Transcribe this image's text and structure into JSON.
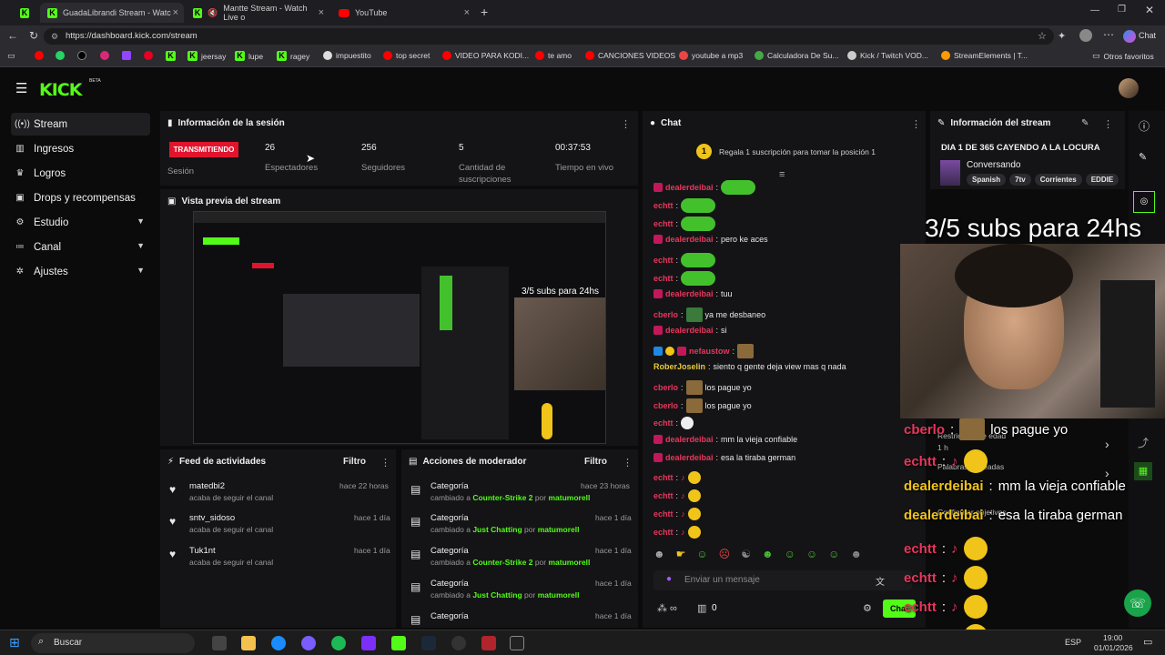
{
  "browser": {
    "tabs": [
      {
        "title": "GuadaLibrandi Stream - Watc"
      },
      {
        "title": "Mantte Stream - Watch Live o"
      },
      {
        "title": "YouTube"
      }
    ],
    "url": "https://dashboard.kick.com/stream",
    "bookmarks": [
      "jeersay",
      "lupe",
      "ragey",
      "impuestito",
      "top secret",
      "VIDEO PARA KODI...",
      "te amo",
      "CANCIONES VIDEOS",
      "youtube a mp3",
      "Calculadora De Su...",
      "Kick / Twitch VOD...",
      "StreamElements | T...",
      "Otros favoritos"
    ]
  },
  "app": {
    "logo": "KICK",
    "beta": "BETA"
  },
  "sidebar": {
    "items": [
      {
        "label": "Stream",
        "icon": "broadcast-icon"
      },
      {
        "label": "Ingresos",
        "icon": "bank-icon"
      },
      {
        "label": "Logros",
        "icon": "trophy-icon"
      },
      {
        "label": "Drops y recompensas",
        "icon": "gift-icon"
      },
      {
        "label": "Estudio",
        "icon": "gear-icon"
      },
      {
        "label": "Canal",
        "icon": "list-icon"
      },
      {
        "label": "Ajustes",
        "icon": "settings-icon"
      }
    ]
  },
  "session": {
    "title": "Información de la sesión",
    "live_badge": "TRANSMITIENDO",
    "stats": [
      {
        "value": "",
        "label": "Sesión"
      },
      {
        "value": "26",
        "label": "Espectadores"
      },
      {
        "value": "256",
        "label": "Seguidores"
      },
      {
        "value": "5",
        "label": "Cantidad de suscripciones"
      },
      {
        "value": "00:37:53",
        "label": "Tiempo en vivo"
      }
    ]
  },
  "preview": {
    "title": "Vista previa del stream",
    "overlay": "3/5 subs para 24hs"
  },
  "feed": {
    "title": "Feed de actividades",
    "filter": "Filtro",
    "items": [
      {
        "name": "matedbi2",
        "sub": "acaba de seguir el canal",
        "time": "hace 22 horas"
      },
      {
        "name": "sntv_sidoso",
        "sub": "acaba de seguir el canal",
        "time": "hace 1 día"
      },
      {
        "name": "Tuk1nt",
        "sub": "acaba de seguir el canal",
        "time": "hace 1 día"
      }
    ]
  },
  "mod": {
    "title": "Acciones de moderador",
    "filter": "Filtro",
    "items": [
      {
        "name": "Categoría",
        "pre": "cambiado a",
        "cat": "Counter-Strike 2",
        "by": "por",
        "user": "matumorell",
        "time": "hace 23 horas"
      },
      {
        "name": "Categoría",
        "pre": "cambiado a",
        "cat": "Just Chatting",
        "by": "por",
        "user": "matumorell",
        "time": "hace 1 día"
      },
      {
        "name": "Categoría",
        "pre": "cambiado a",
        "cat": "Counter-Strike 2",
        "by": "por",
        "user": "matumorell",
        "time": "hace 1 día"
      },
      {
        "name": "Categoría",
        "pre": "cambiado a",
        "cat": "Just Chatting",
        "by": "por",
        "user": "matumorell",
        "time": "hace 1 día"
      },
      {
        "name": "Categoría",
        "pre": "",
        "cat": "",
        "by": "",
        "user": "",
        "time": "hace 1 día"
      }
    ]
  },
  "chat": {
    "title": "Chat",
    "gift_text": "Regala 1 suscripción para tomar la posición 1",
    "gift_rank": "1",
    "input_placeholder": "Enviar un mensaje",
    "points": "0",
    "chat_btn": "Cha",
    "messages": [
      {
        "user": "dealerdeibai",
        "text": ""
      },
      {
        "user": "echtt",
        "text": ""
      },
      {
        "user": "echtt",
        "text": ""
      },
      {
        "user": "dealerdeibai",
        "text": "pero ke aces"
      },
      {
        "user": "echtt",
        "text": ""
      },
      {
        "user": "echtt",
        "text": ""
      },
      {
        "user": "dealerdeibai",
        "text": "tuu"
      },
      {
        "user": "cberlo",
        "text": "ya me desbaneo"
      },
      {
        "user": "dealerdeibai",
        "text": "si"
      },
      {
        "user": "nefaustow",
        "text": ""
      },
      {
        "user": "RoberJoselin",
        "text": "siento q gente deja view mas q nada"
      },
      {
        "user": "cberlo",
        "text": "los pague yo"
      },
      {
        "user": "cberlo",
        "text": "los pague yo"
      },
      {
        "user": "echtt",
        "text": ""
      },
      {
        "user": "dealerdeibai",
        "text": "mm la vieja confiable"
      },
      {
        "user": "dealerdeibai",
        "text": "esa la tiraba german"
      },
      {
        "user": "echtt",
        "text": ""
      },
      {
        "user": "echtt",
        "text": ""
      },
      {
        "user": "echtt",
        "text": ""
      },
      {
        "user": "echtt",
        "text": ""
      }
    ]
  },
  "streaminfo": {
    "title": "Información del stream",
    "stream_title": "DIA 1 DE 365 CAYENDO A LA LOCURA",
    "category": "Conversando",
    "tags": [
      "Spanish",
      "7tv",
      "Corrientes",
      "EDDIE"
    ]
  },
  "overlay": {
    "subs": "3/5 subs para 24hs",
    "lines": [
      {
        "user": "cberlo",
        "text": "los pague yo"
      },
      {
        "user": "echtt",
        "text": ""
      },
      {
        "user": "dealerdeibai",
        "text": "mm la vieja confiable"
      },
      {
        "user": "dealerdeibai",
        "text": "esa la tiraba german"
      },
      {
        "user": "echtt",
        "text": ""
      },
      {
        "user": "echtt",
        "text": ""
      },
      {
        "user": "echtt",
        "text": ""
      },
      {
        "user": "echtt",
        "text": ""
      }
    ],
    "ghost": [
      "Restricción de edad",
      "1 h",
      "Palabras baneadas",
      "Configurar objetivos",
      "Coleado"
    ]
  },
  "taskbar": {
    "search": "Buscar",
    "lang": "ESP",
    "time": "19:00",
    "date": "01/01/2026"
  }
}
